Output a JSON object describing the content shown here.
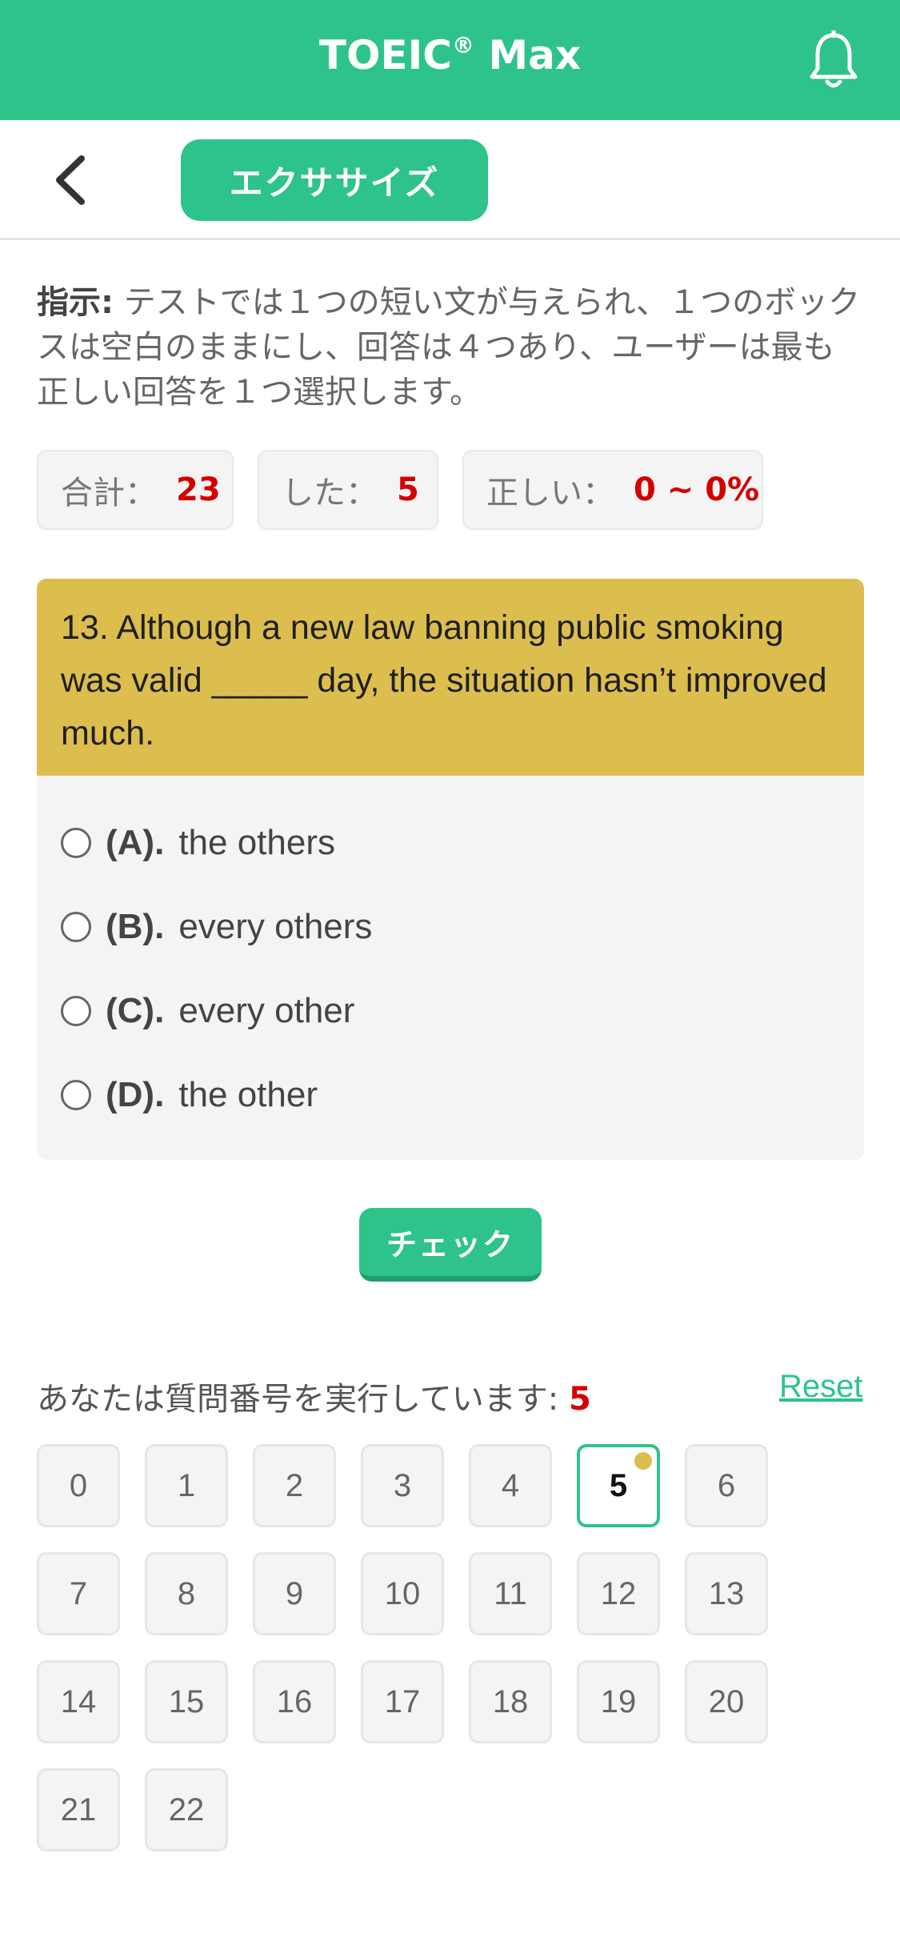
{
  "colors": {
    "accent": "#2ec38a",
    "question_bg": "#dcbe4f",
    "value_red": "#d40000"
  },
  "appbar": {
    "title": "TOEIC",
    "title_sup": "®",
    "title_suffix": " Max",
    "bell_icon": "bell-icon"
  },
  "subbar": {
    "back_icon": "chevron-left-icon",
    "mode_label": "エクササイズ"
  },
  "instructions": {
    "label": "指示:",
    "text": " テストでは１つの短い文が与えられ、１つのボックスは空白のままにし、回答は４つあり、ユーザーは最も正しい回答を１つ選択します。"
  },
  "stats": {
    "total_label": "合計：",
    "total_value": "23",
    "done_label": "した：",
    "done_value": "5",
    "correct_label": "正しい：",
    "correct_value": "0 ~ 0%"
  },
  "question": {
    "text": "13. Although a new law banning public smoking was valid _____ day, the situation hasn’t improved much.",
    "options": [
      {
        "key": "(A).",
        "text": "the others"
      },
      {
        "key": "(B).",
        "text": "every others"
      },
      {
        "key": "(C).",
        "text": "every other"
      },
      {
        "key": "(D).",
        "text": "the other"
      }
    ]
  },
  "check_label": "チェック",
  "progress": {
    "label": "あなたは質問番号を実行しています:",
    "current": "5",
    "reset_label": "Reset"
  },
  "question_numbers": [
    "0",
    "1",
    "2",
    "3",
    "4",
    "5",
    "6",
    "7",
    "8",
    "9",
    "10",
    "11",
    "12",
    "13",
    "14",
    "15",
    "16",
    "17",
    "18",
    "19",
    "20",
    "21",
    "22"
  ],
  "active_number": "5"
}
